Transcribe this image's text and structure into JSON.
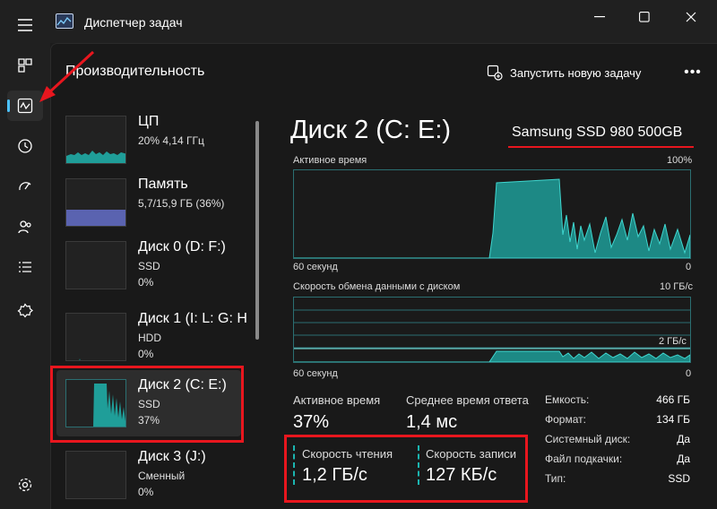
{
  "window": {
    "title": "Диспетчер задач"
  },
  "header": {
    "page_title": "Производительность",
    "run_task_label": "Запустить новую задачу",
    "more_label": "•••"
  },
  "nav": {
    "items": [
      {
        "icon": "hamburger-menu-icon"
      },
      {
        "icon": "processes-icon"
      },
      {
        "icon": "performance-icon",
        "active": true
      },
      {
        "icon": "app-history-icon"
      },
      {
        "icon": "startup-apps-icon"
      },
      {
        "icon": "users-icon"
      },
      {
        "icon": "details-icon"
      },
      {
        "icon": "services-icon"
      },
      {
        "icon": "settings-icon"
      }
    ]
  },
  "devices": [
    {
      "name": "ЦП",
      "line1": "20%  4,14 ГГц",
      "line2": ""
    },
    {
      "name": "Память",
      "line1": "5,7/15,9 ГБ (36%)",
      "line2": ""
    },
    {
      "name": "Диск 0 (D: F:)",
      "line1": "SSD",
      "line2": "0%"
    },
    {
      "name": "Диск 1 (I: L: G: H",
      "line1": "HDD",
      "line2": "0%"
    },
    {
      "name": "Диск 2 (C: E:)",
      "line1": "SSD",
      "line2": "37%",
      "selected": true
    },
    {
      "name": "Диск 3 (J:)",
      "line1": "Сменный",
      "line2": "0%"
    }
  ],
  "detail": {
    "title": "Диск 2 (C: E:)",
    "model": "Samsung SSD 980 500GB",
    "graph1": {
      "label": "Активное время",
      "max": "100%",
      "xlabel": "60 секунд",
      "min": "0"
    },
    "graph2": {
      "label": "Скорость обмена данными с диском",
      "max": "10 ГБ/с",
      "mid": "2 ГБ/с",
      "xlabel": "60 секунд",
      "min": "0"
    },
    "stats": {
      "active_time_label": "Активное время",
      "active_time_value": "37%",
      "avg_response_label": "Среднее время ответа",
      "avg_response_value": "1,4 мс",
      "read_label": "Скорость чтения",
      "read_value": "1,2 ГБ/с",
      "write_label": "Скорость записи",
      "write_value": "127 КБ/с"
    },
    "props": [
      {
        "key": "Емкость:",
        "value": "466 ГБ"
      },
      {
        "key": "Формат:",
        "value": "134 ГБ"
      },
      {
        "key": "Системный диск:",
        "value": "Да"
      },
      {
        "key": "Файл подкачки:",
        "value": "Да"
      },
      {
        "key": "Тип:",
        "value": "SSD"
      }
    ]
  },
  "colors": {
    "accent": "#4cc2ff",
    "graph": "#1f9e99",
    "annotation": "#e8161e"
  }
}
